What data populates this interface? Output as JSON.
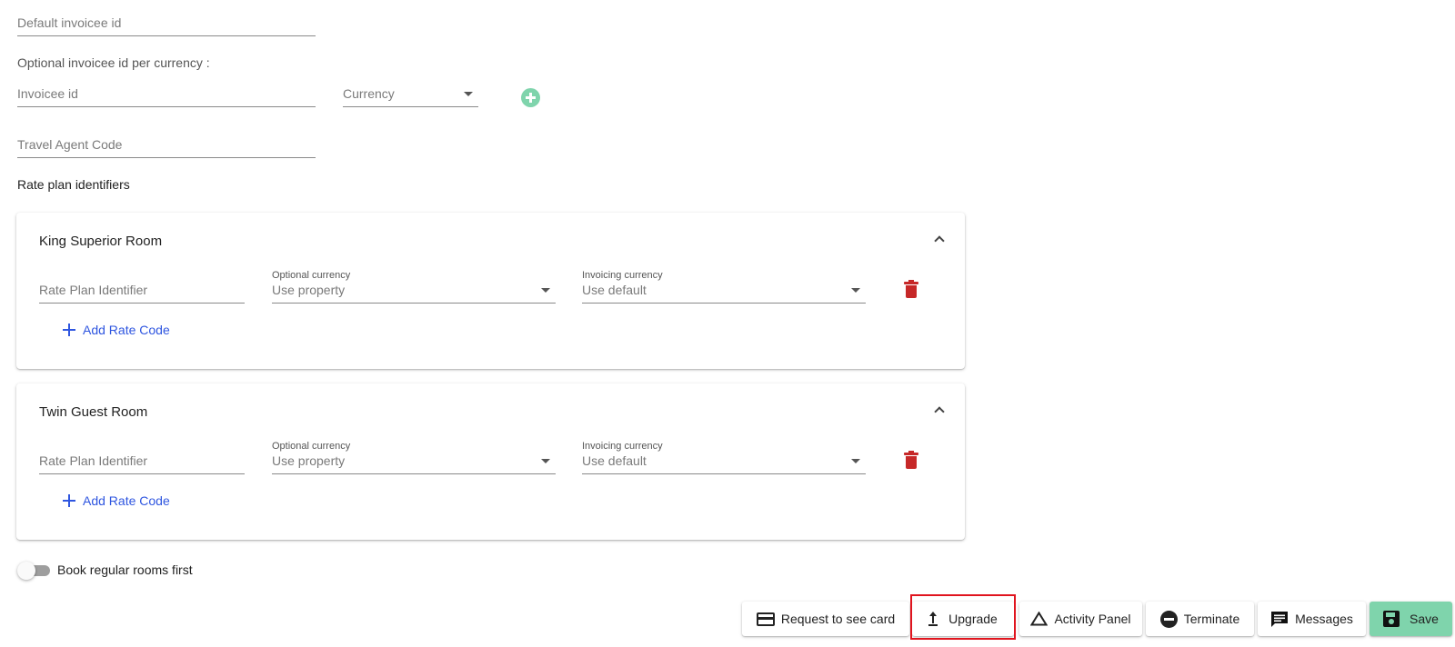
{
  "form": {
    "default_invoicee_placeholder": "Default invoicee id",
    "optional_invoicee_label": "Optional invoicee id per currency :",
    "invoicee_id_placeholder": "Invoicee id",
    "currency_placeholder": "Currency",
    "travel_agent_placeholder": "Travel Agent Code",
    "rate_plan_section_label": "Rate plan identifiers"
  },
  "rooms": [
    {
      "title": "King Superior Room",
      "rate_plan_placeholder": "Rate Plan Identifier",
      "optional_currency_label": "Optional currency",
      "optional_currency_value": "Use property",
      "invoicing_currency_label": "Invoicing currency",
      "invoicing_currency_value": "Use default",
      "add_rate_code_label": "Add Rate Code"
    },
    {
      "title": "Twin Guest Room",
      "rate_plan_placeholder": "Rate Plan Identifier",
      "optional_currency_label": "Optional currency",
      "optional_currency_value": "Use property",
      "invoicing_currency_label": "Invoicing currency",
      "invoicing_currency_value": "Use default",
      "add_rate_code_label": "Add Rate Code"
    }
  ],
  "toggle": {
    "label": "Book regular rooms first",
    "checked": false
  },
  "actions": {
    "request_card": "Request to see card",
    "upgrade": "Upgrade",
    "activity_panel": "Activity Panel",
    "terminate": "Terminate",
    "messages": "Messages",
    "save": "Save"
  },
  "colors": {
    "accent_green": "#7fd4ac",
    "link_blue": "#2f56e0",
    "delete_red": "#c62828",
    "highlight_red": "#e0141e"
  }
}
